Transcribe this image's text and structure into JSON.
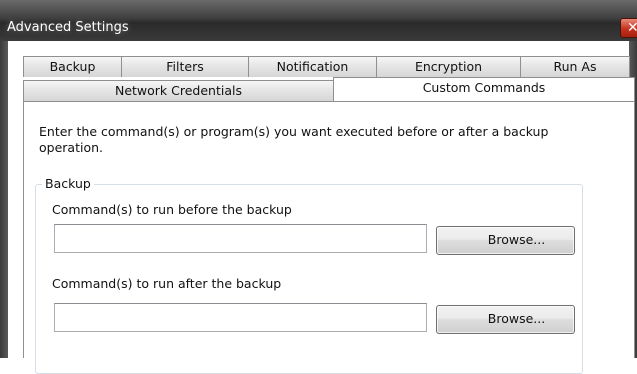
{
  "window": {
    "title": "Advanced Settings",
    "close_glyph": "✕"
  },
  "tabs": {
    "row1": [
      {
        "label": "Backup"
      },
      {
        "label": "Filters"
      },
      {
        "label": "Notification"
      },
      {
        "label": "Encryption"
      },
      {
        "label": "Run As"
      }
    ],
    "row2": [
      {
        "label": "Network Credentials",
        "active": false
      },
      {
        "label": "Custom Commands",
        "active": true
      }
    ]
  },
  "panel": {
    "instructions": "Enter the command(s) or program(s) you want executed before or after a backup operation.",
    "group_label": "Backup",
    "before": {
      "label": "Command(s) to run before the backup",
      "value": "",
      "browse_label": "Browse..."
    },
    "after": {
      "label": "Command(s) to run after the backup",
      "value": "",
      "browse_label": "Browse..."
    }
  }
}
